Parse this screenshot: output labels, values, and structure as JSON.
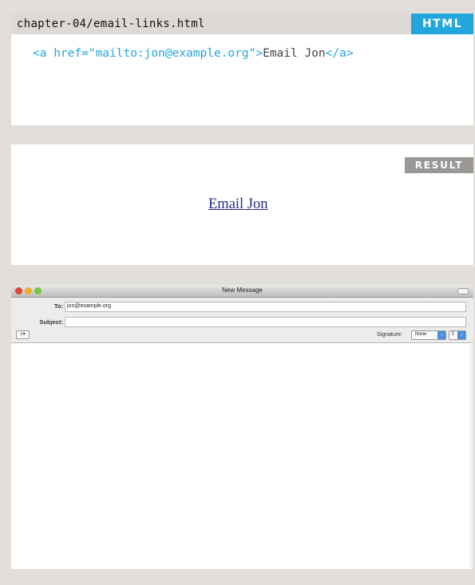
{
  "code_panel": {
    "filename": "chapter-04/email-links.html",
    "badge": "HTML",
    "code": {
      "tag_open": "<a href=\"mailto:jon@example.org\">",
      "text": "Email Jon",
      "tag_close": "</a>"
    }
  },
  "result_panel": {
    "badge": "RESULT",
    "link_text": "Email Jon"
  },
  "mail_window": {
    "title": "New Message",
    "to_label": "To:",
    "to_value": "jon@example.org",
    "subject_label": "Subject:",
    "subject_value": "",
    "format_button": "≡▾",
    "signature_label": "Signature:",
    "signature_value": "None",
    "priority_value": "!",
    "stepper_glyph": "↕"
  },
  "colors": {
    "background": "#e2dfdb",
    "html_badge": "#22a6dd",
    "result_badge": "#999896",
    "code_tag": "#22a6dd",
    "link": "#2a2a8a"
  }
}
